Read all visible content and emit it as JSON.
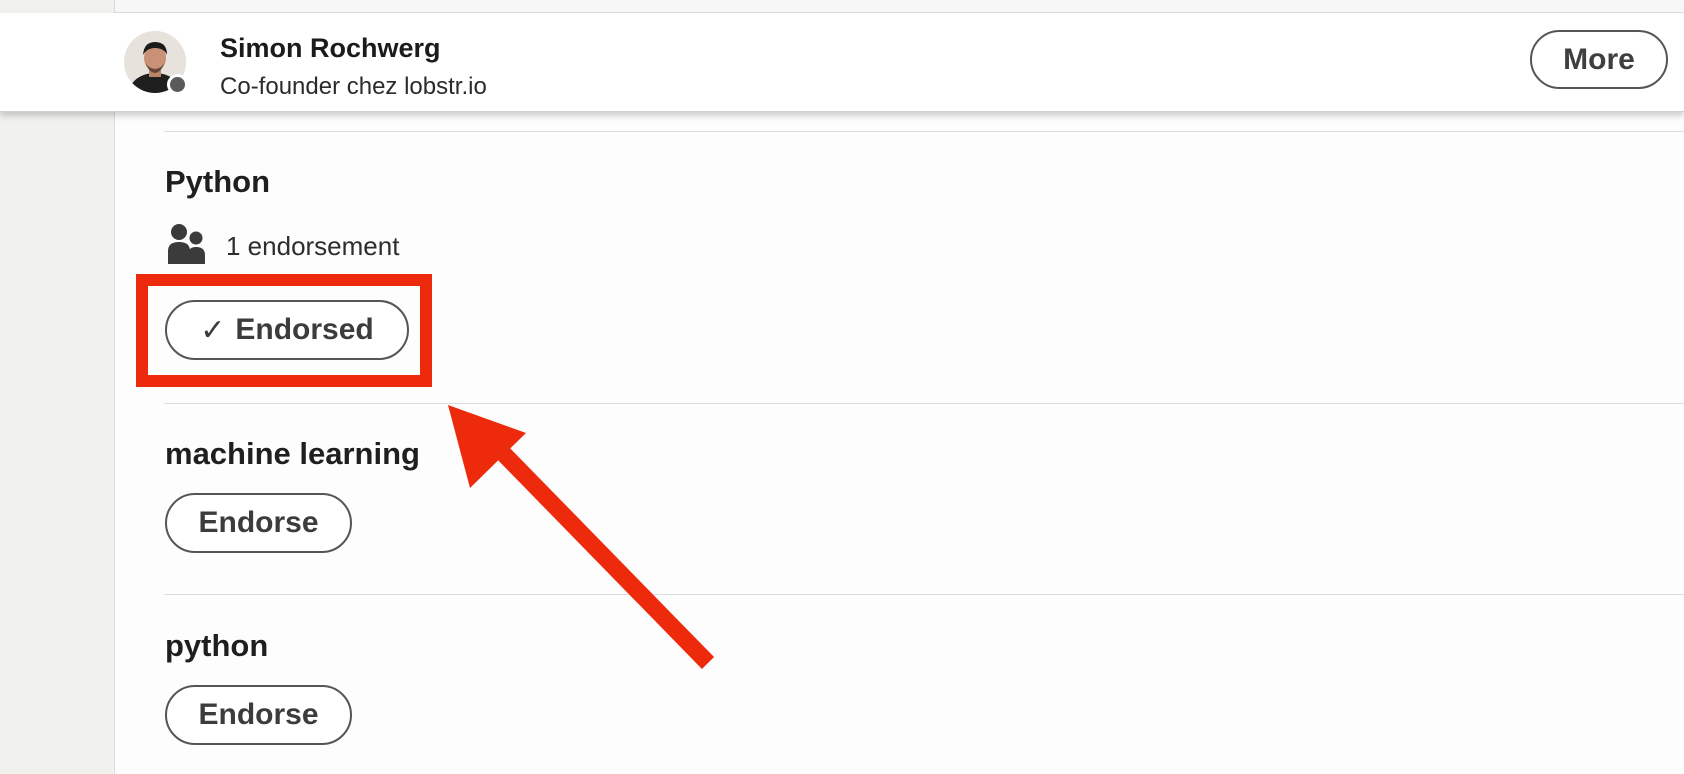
{
  "profile": {
    "name": "Simon Rochwerg",
    "headline": "Co-founder chez lobstr.io",
    "avatar_icon": "profile-photo",
    "presence_icon": "presence-dot"
  },
  "header": {
    "more_label": "More"
  },
  "skills": [
    {
      "name": "Python",
      "endorsement_count_text": "1 endorsement",
      "endorsement_icon": "people-icon",
      "button_label": "Endorsed",
      "button_prefix": "✓"
    },
    {
      "name": "machine learning",
      "button_label": "Endorse"
    },
    {
      "name": "python",
      "button_label": "Endorse"
    }
  ],
  "annotation": {
    "color": "#ee2a0d",
    "highlight_target": "Endorsed"
  },
  "colors": {
    "button_border": "#555555",
    "button_text": "#3c3c3c",
    "gutter": "#f1f1ee"
  }
}
